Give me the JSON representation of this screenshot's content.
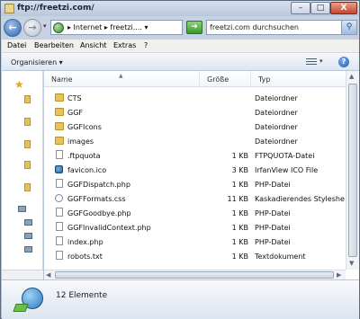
{
  "window": {
    "title": "ftp://freetzi.com/",
    "minimize_label": "–",
    "maximize_label": "□",
    "close_label": "X"
  },
  "address_bar": {
    "location": "▸ Internet ▸ freetzi.... ▾",
    "search_placeholder": "freetzi.com durchsuchen"
  },
  "menu": {
    "items": [
      {
        "label": "Datei"
      },
      {
        "label": "Bearbeiten"
      },
      {
        "label": "Ansicht"
      },
      {
        "label": "Extras"
      },
      {
        "label": "?"
      }
    ]
  },
  "command_bar": {
    "organize_label": "Organisieren ▾"
  },
  "columns": {
    "name": "Name",
    "size": "Größe",
    "type": "Typ"
  },
  "files": [
    {
      "name": "CTS",
      "size": "",
      "type": "Dateiordner",
      "icon": "folder-icon"
    },
    {
      "name": "GGF",
      "size": "",
      "type": "Dateiordner",
      "icon": "folder-icon"
    },
    {
      "name": "GGFIcons",
      "size": "",
      "type": "Dateiordner",
      "icon": "folder-icon"
    },
    {
      "name": "images",
      "size": "",
      "type": "Dateiordner",
      "icon": "folder-icon"
    },
    {
      "name": ".ftpquota",
      "size": "1 KB",
      "type": "FTPQUOTA-Datei",
      "icon": "file-icon"
    },
    {
      "name": "favicon.ico",
      "size": "3 KB",
      "type": "IrfanView ICO File",
      "icon": "ico-file-icon"
    },
    {
      "name": "GGFDispatch.php",
      "size": "1 KB",
      "type": "PHP-Datei",
      "icon": "php-file-icon"
    },
    {
      "name": "GGFFormats.css",
      "size": "11 KB",
      "type": "Kaskadierendes Stylesheet-...",
      "icon": "css-file-icon"
    },
    {
      "name": "GGFGoodbye.php",
      "size": "1 KB",
      "type": "PHP-Datei",
      "icon": "php-file-icon"
    },
    {
      "name": "GGFInvalidContext.php",
      "size": "1 KB",
      "type": "PHP-Datei",
      "icon": "php-file-icon"
    },
    {
      "name": "index.php",
      "size": "1 KB",
      "type": "PHP-Datei",
      "icon": "php-file-icon"
    },
    {
      "name": "robots.txt",
      "size": "1 KB",
      "type": "Textdokument",
      "icon": "text-file-icon"
    }
  ],
  "details": {
    "count_text": "12 Elemente"
  }
}
